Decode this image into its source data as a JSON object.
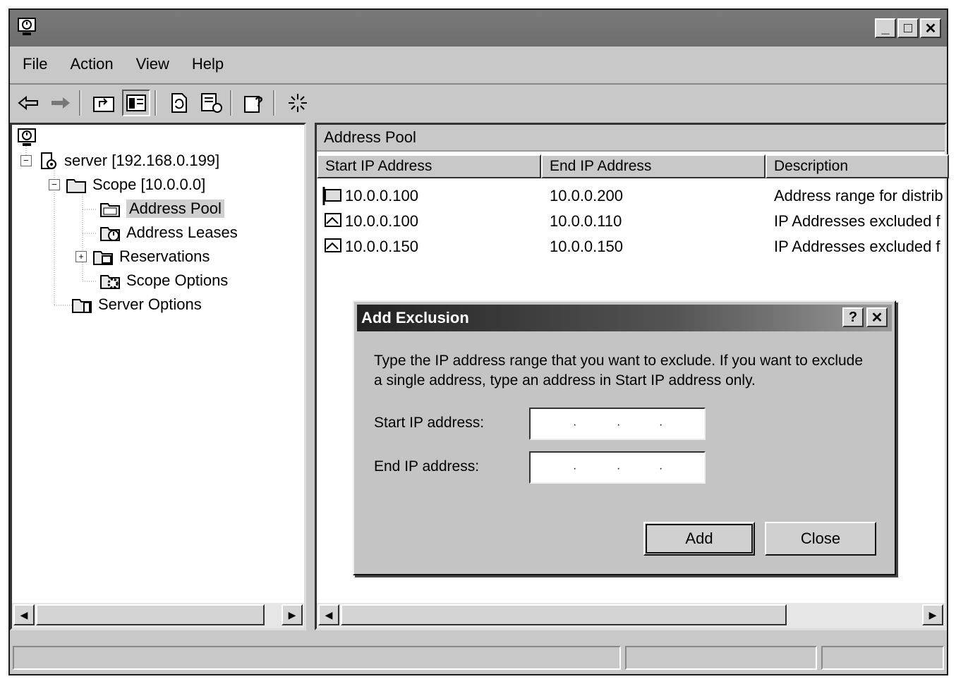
{
  "menu": [
    "File",
    "Action",
    "View",
    "Help"
  ],
  "toolbar_icons": [
    "back-icon",
    "forward-icon",
    "up-level-icon",
    "show-hide-tree-icon",
    "refresh-icon",
    "export-list-icon",
    "help-icon",
    "dhcp-activity-icon"
  ],
  "tree": {
    "server": "server [192.168.0.199]",
    "scope": "Scope [10.0.0.0]",
    "address_pool": "Address Pool",
    "address_leases": "Address Leases",
    "reservations": "Reservations",
    "scope_options": "Scope Options",
    "server_options": "Server Options"
  },
  "right": {
    "header": "Address Pool",
    "columns": [
      "Start IP Address",
      "End IP Address",
      "Description"
    ],
    "rows": [
      {
        "start": "10.0.0.100",
        "end": "10.0.0.200",
        "desc": "Address range for distrib"
      },
      {
        "start": "10.0.0.100",
        "end": "10.0.0.110",
        "desc": "IP Addresses excluded f"
      },
      {
        "start": "10.0.0.150",
        "end": "10.0.0.150",
        "desc": "IP Addresses excluded f"
      }
    ]
  },
  "dialog": {
    "title": "Add Exclusion",
    "help_btn": "?",
    "close_btn": "✕",
    "instructions": "Type the IP address range that you want to exclude. If you want to exclude a single address, type an address in Start IP address only.",
    "start_label": "Start IP address:",
    "end_label": "End IP address:",
    "start_value": "",
    "end_value": "",
    "add_button": "Add",
    "close_button": "Close"
  }
}
